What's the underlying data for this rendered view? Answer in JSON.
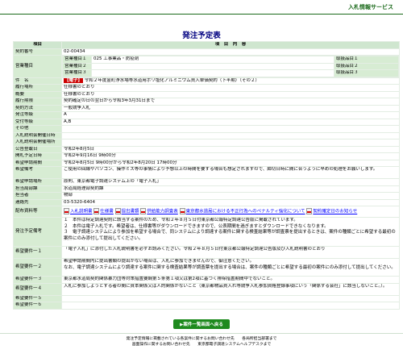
{
  "service_title": "入札情報サービス",
  "page_title": "発注予定表",
  "headers": {
    "item": "項目",
    "content": "項　目　内　容"
  },
  "rows": {
    "contract_no": {
      "label": "契約番号",
      "value": "02-00434"
    },
    "business": {
      "label": "営業種目",
      "items": [
        {
          "label": "営業種目１",
          "value": "025 工事業品・防疫剤",
          "sub": "取扱品目１"
        },
        {
          "label": "営業種目２",
          "value": "",
          "sub": "取扱品目２"
        },
        {
          "label": "営業種目３",
          "value": "",
          "sub": "取扱品目３"
        }
      ]
    },
    "name": {
      "label": "件　名",
      "badge": "【電子】",
      "value": "令和２年度金町浄水場等水道用ポリ塩化アルミニウム買入単価契約（下半期）（その２）"
    },
    "location": {
      "label": "履行場所",
      "value": "仕様書のとおり"
    },
    "summary": {
      "label": "概要",
      "value": "仕様書のとおり"
    },
    "period": {
      "label": "履行期限",
      "value": "契約確定の日の翌日から令和3年3月31日まで"
    },
    "method": {
      "label": "契約方法",
      "value": "一般競争入札"
    },
    "grade": {
      "label": "発注等級",
      "value": "A"
    },
    "accept_grade": {
      "label": "受付等級",
      "value": "A,B"
    },
    "other": {
      "label": "その他",
      "value": ""
    },
    "briefing_date": {
      "label": "入札説明会開催日時",
      "value": ""
    },
    "briefing_place": {
      "label": "入札説明会開催場所",
      "value": ""
    },
    "announce": {
      "label": "公告登載日",
      "value": "令和2年8月5日"
    },
    "open_date": {
      "label": "開札予定日時",
      "value": "令和2年9月16日 9時00分"
    },
    "apply_period": {
      "label": "希望申請期間",
      "value": "令和2年8月5日 9時00分から令和2年8月20日 17時00分"
    },
    "apply_note": {
      "label": "希望備考",
      "value": "ご使用の回線やパソコン、操作ミス等の事情により予想以上の時間を要する場合も想定されますので、締切日時に間に合うように早めの処理をお願いします。"
    },
    "apply_place": {
      "label": "希望申請場所",
      "value": "原則、東京都電子調達システム上の「電子入札」"
    },
    "dept": {
      "label": "担当局部課",
      "value": "水道局経理部契約課"
    },
    "person": {
      "label": "担当者",
      "value": "物部"
    },
    "contact": {
      "label": "連絡先",
      "value": "03-5320-6404"
    },
    "docs": {
      "label": "配布資料等",
      "links": [
        "入札説明書",
        "仕様書",
        "提出書類",
        "供給能力調査表",
        "東京都水道局における不正行為へのペナルティ強化について",
        "契約確定日のお知らせ"
      ]
    },
    "schedule": {
      "label": "発注予定備考",
      "value": "１　本件は特定調達契約に該当する案件のため、令和２年８月５日付東京都公報特定調達公告版に掲載されています。\n２　本件は電子入札です。希望者は、仕様書等がダウンロードできますので、公表期間を過ぎますとダウンロードできなくなります。\n３　電子調達システムにより参加を希望する場合で、同システムにより調達する案件に関する検査結果等が調査票を提出するときは、案件の種類ごとに希望する最初の案件にのみ添付して提出してください。"
    },
    "req1": {
      "label": "希望要件一１",
      "value": "「電子入札」に添付した入札説明書を必ずお読みください。令和２年８月５日付東京都公報特定調達公告版及び入札説明書のとおり"
    },
    "req2": {
      "label": "希望要件一２",
      "value": "希望申請期間内に提出書類の提出がない場合は、入札に参加できませんので、御注意ください。\nなお、電子調達システムにより調達する案件に関する検査結果等が調査票を提出する場合は、案件の種類ごとに希望する最初の案件にのみ添付して提出してください。"
    },
    "req3": {
      "label": "希望要件一３",
      "value": "東京都水道局契約関係暴力団等対策措置要綱第５条第１項又は第2項に基づく排除措置期間中でないこと。"
    },
    "req4": {
      "label": "希望要件一４",
      "value": "入札に参加しようとする者の間に資本関係又は人的関係がないこと（東京都物品買入れ等競争入札参加資格登録事項にいう「関係する会社」に該当しないこと。）。"
    },
    "req5": {
      "label": "希望要件一５",
      "value": ""
    },
    "req6": {
      "label": "希望要件一６",
      "value": ""
    }
  },
  "back_button": "▶案件一覧画面へ戻る",
  "footer": {
    "line1": "発注予定情報に掲載されている各案件に関するお問い合わせ先　　各局所担当部署まで",
    "line2": "画面操作に関するお問い合わせ先　　東京都電子調達システムヘルプデスクまで"
  },
  "colors": {
    "label_bg": "#d7ecd3",
    "accent": "#1e8a1e",
    "title": "#000080",
    "badge": "#cc0000"
  }
}
